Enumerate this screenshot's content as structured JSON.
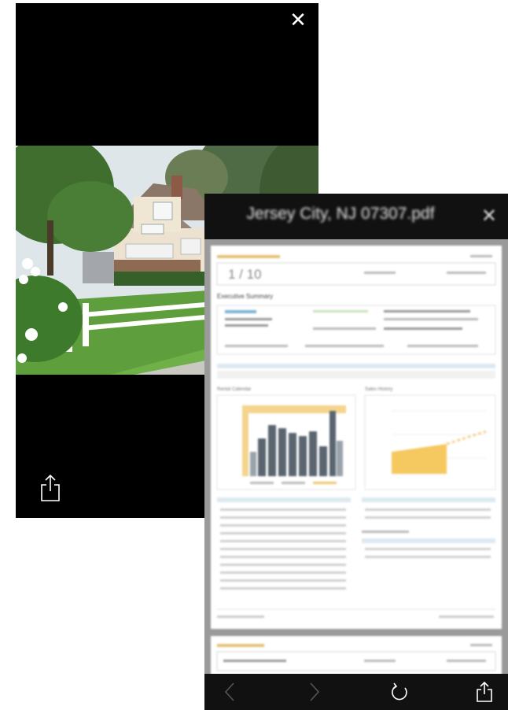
{
  "photo_viewer": {
    "close_icon": "close-icon",
    "share_icon": "share-icon",
    "background": "#000000"
  },
  "pdf_viewer": {
    "title": "Jersey City, NJ 07307.pdf",
    "close_icon": "close-icon",
    "header_background": "#111111",
    "page": {
      "score": "1 / 10",
      "section_title": "Executive Summary",
      "chart_left_title": "Rental Calendar",
      "chart_right_title": "Sales History"
    },
    "toolbar": {
      "back_icon": "chevron-left-icon",
      "forward_icon": "chevron-right-icon",
      "reload_icon": "reload-icon",
      "share_icon": "share-icon"
    }
  }
}
